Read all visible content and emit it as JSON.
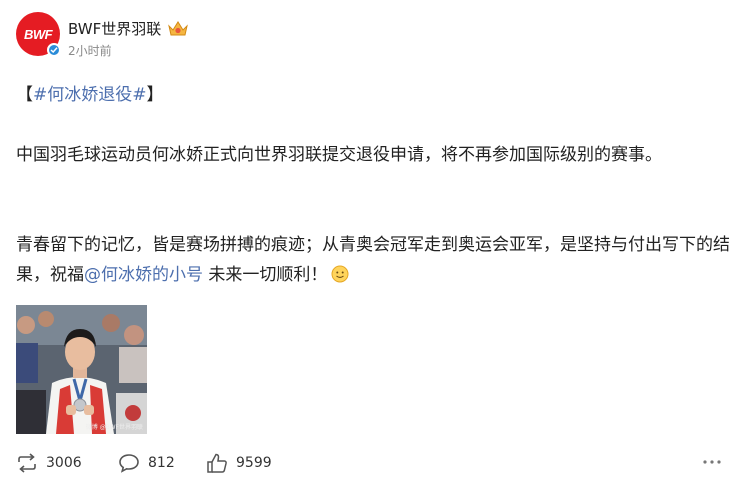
{
  "post": {
    "author": "BWF世界羽联",
    "avatar_text": "BWF",
    "timestamp": "2小时前",
    "topic_open": "【",
    "topic": "#何冰娇退役#",
    "topic_close": "】",
    "paragraph1": "中国羽毛球运动员何冰娇正式向世界羽联提交退役申请，将不再参加国际级别的赛事。",
    "paragraph2_before": "青春留下的记忆，皆是赛场拼搏的痕迹；从青奥会冠军走到奥运会亚军，是坚持与付出写下的结果，祝福",
    "mention": "@何冰娇的小号",
    "paragraph2_after": " 未来一切顺利！",
    "image_watermark": "微博 @BWF世界羽联"
  },
  "actions": {
    "repost_count": "3006",
    "comment_count": "812",
    "like_count": "9599"
  },
  "colors": {
    "link": "#4d6fae",
    "avatar_bg": "#e51c23",
    "verified": "#2a8cd8"
  }
}
